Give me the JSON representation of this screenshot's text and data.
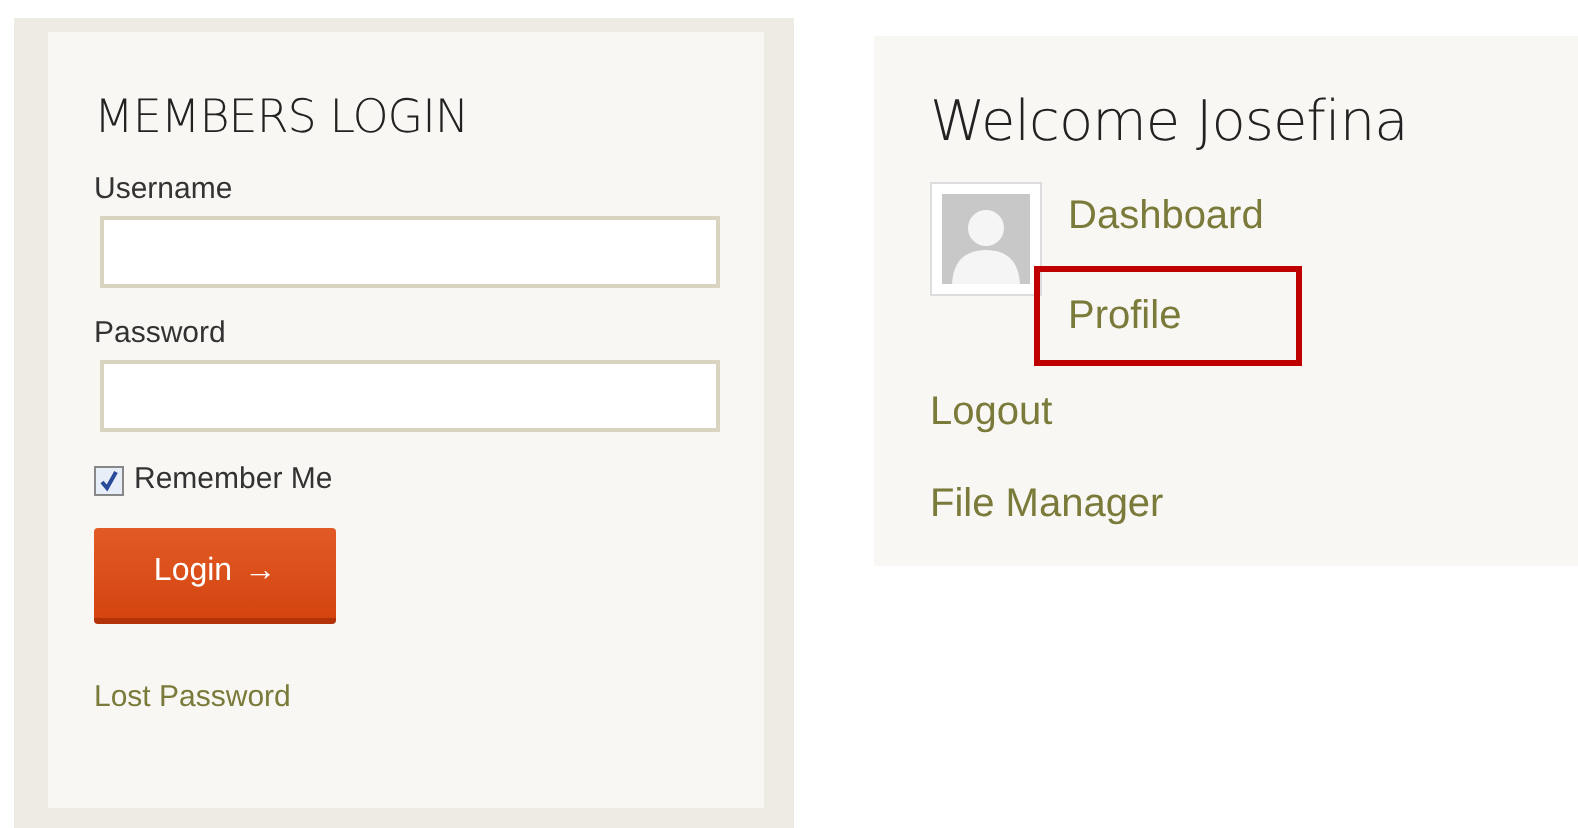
{
  "login": {
    "title": "MEMBERS LOGIN",
    "fields": [
      {
        "label": "Username"
      },
      {
        "label": "Password"
      }
    ],
    "remember": {
      "label": "Remember Me",
      "checked": true
    },
    "button": {
      "label": "Login",
      "arrow": "→"
    },
    "lost_password": "Lost Password"
  },
  "welcome": {
    "title": "Welcome Josefina",
    "avatar_links": [
      {
        "label": "Dashboard",
        "highlighted": false
      },
      {
        "label": "Profile",
        "highlighted": true
      }
    ],
    "links": [
      {
        "label": "Logout",
        "highlighted": false
      },
      {
        "label": "File Manager",
        "highlighted": false
      }
    ]
  }
}
